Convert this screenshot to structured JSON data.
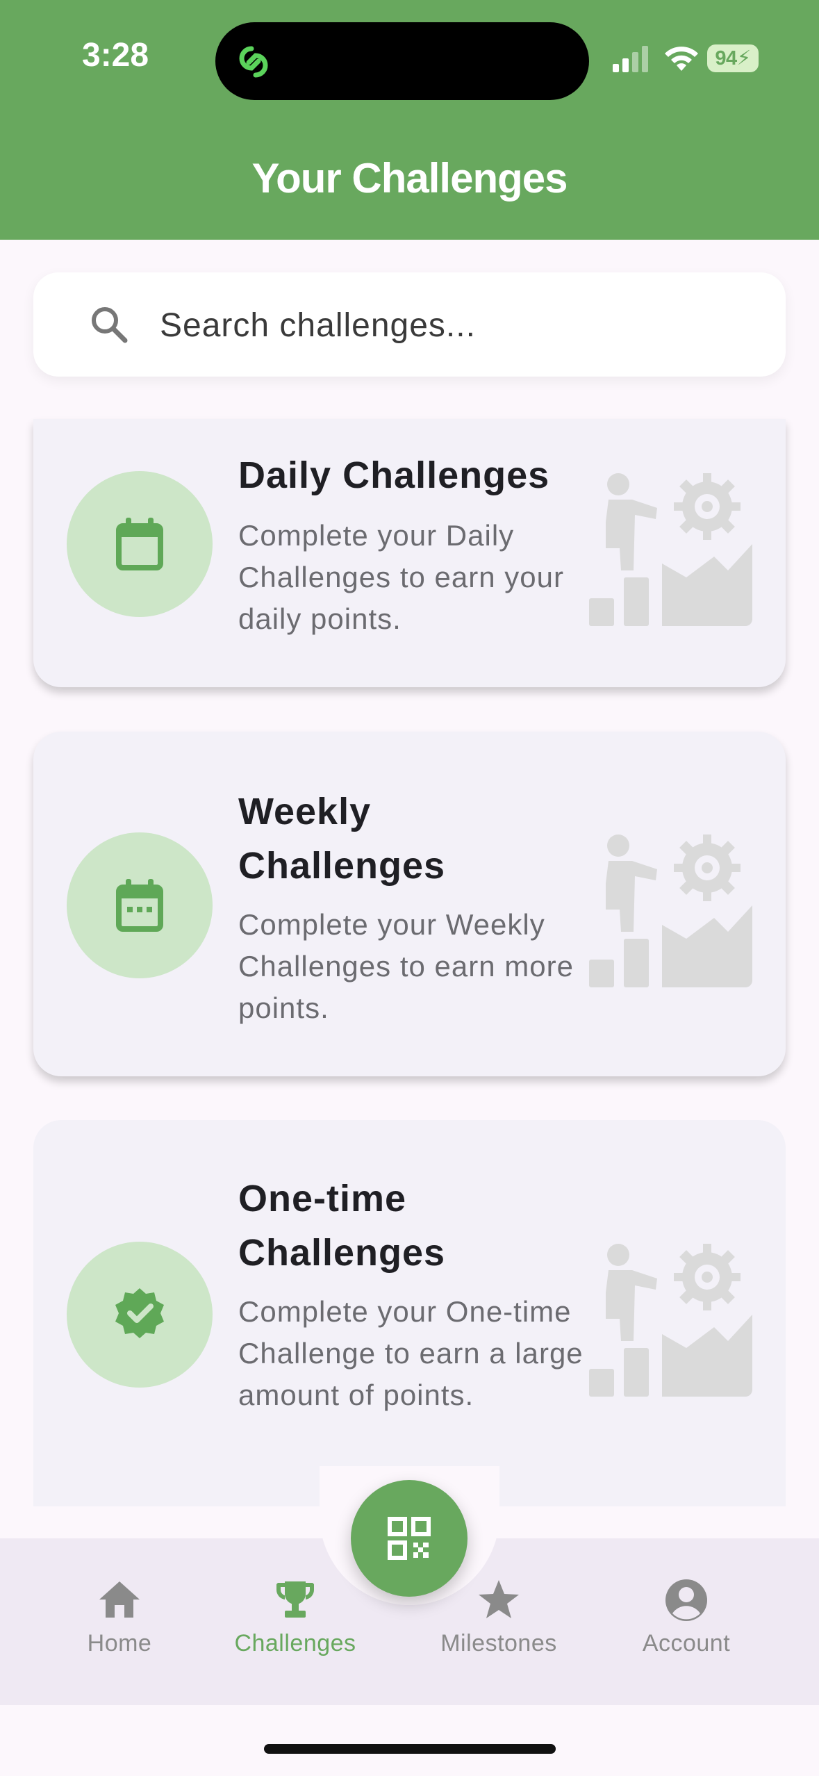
{
  "status_bar": {
    "time": "3:28",
    "battery": "94"
  },
  "header": {
    "title": "Your Challenges"
  },
  "search": {
    "placeholder": "Search challenges..."
  },
  "challenges": [
    {
      "title": "Daily Challenges",
      "description": "Complete your Daily Challenges to earn your daily points.",
      "icon": "calendar-icon"
    },
    {
      "title": "Weekly Challenges",
      "description": "Complete your Weekly Challenges to earn more points.",
      "icon": "calendar-week-icon"
    },
    {
      "title": "One-time Challenges",
      "description": "Complete your One-time Challenge to earn a large amount of points.",
      "icon": "verified-badge-icon"
    }
  ],
  "nav": {
    "items": [
      {
        "label": "Home",
        "icon": "home-icon"
      },
      {
        "label": "Challenges",
        "icon": "trophy-icon",
        "active": true
      },
      {
        "label": "Milestones",
        "icon": "star-icon"
      },
      {
        "label": "Account",
        "icon": "account-circle-icon"
      }
    ],
    "fab_icon": "qr-code-icon"
  },
  "colors": {
    "primary": "#68A85E",
    "icon_circle": "#CDE6C8",
    "card_bg": "#F3F1F8",
    "nav_bg": "#EFE9F3",
    "inactive": "#8a8a8a"
  }
}
